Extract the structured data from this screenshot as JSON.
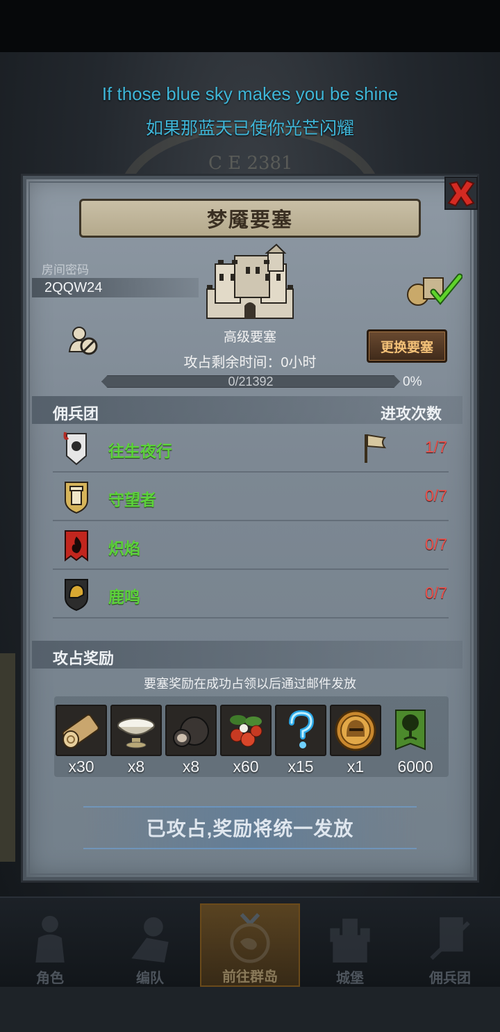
{
  "subtitles": {
    "en": "If those blue sky makes you be shine",
    "zh": "如果那蓝天已使你光芒闪耀"
  },
  "background": {
    "clock_text": "C E 2381"
  },
  "dialog": {
    "title": "梦魇要塞",
    "room_label": "房间密码",
    "room_code": "2QQW24",
    "castle_name": "高级要塞",
    "time_left": "攻占剩余时间：0小时",
    "change_button": "更换要塞",
    "progress": {
      "text": "0/21392",
      "percent_label": "0%",
      "fraction": 0
    },
    "mercenary_header": "佣兵团",
    "attacks_header": "进攻次数",
    "mercenaries": [
      {
        "name": "往生夜行",
        "count": "1/7",
        "emblem": "skull-banner-icon",
        "flag": true
      },
      {
        "name": "守望者",
        "count": "0/7",
        "emblem": "tower-shield-icon",
        "flag": false
      },
      {
        "name": "炽焰",
        "count": "0/7",
        "emblem": "flame-banner-icon",
        "flag": false
      },
      {
        "name": "鹿鸣",
        "count": "0/7",
        "emblem": "helmet-shield-icon",
        "flag": false
      }
    ],
    "rewards_header": "攻占奖励",
    "rewards_note": "要塞奖励在成功占领以后通过邮件发放",
    "rewards": [
      {
        "icon": "wood-log-icon",
        "qty": "x30"
      },
      {
        "icon": "silver-bowl-icon",
        "qty": "x8"
      },
      {
        "icon": "truffle-icon",
        "qty": "x8"
      },
      {
        "icon": "berries-icon",
        "qty": "x60"
      },
      {
        "icon": "mystery-question-icon",
        "qty": "x15"
      },
      {
        "icon": "gold-helmet-coin-icon",
        "qty": "x1"
      },
      {
        "icon": "tree-banner-icon",
        "qty": "6000"
      }
    ],
    "status_button": "已攻占,奖励将统一发放"
  },
  "nav": [
    {
      "label": "角色",
      "icon": "knight-icon"
    },
    {
      "label": "编队",
      "icon": "formation-icon"
    },
    {
      "label": "前往群岛",
      "icon": "islands-globe-icon",
      "active": true
    },
    {
      "label": "城堡",
      "icon": "castle-icon"
    },
    {
      "label": "佣兵团",
      "icon": "mercenary-icon"
    }
  ],
  "colors": {
    "subtitle": "#3fb6d8",
    "mercenary_name": "#5cd23a",
    "attack_count": "#e8534e",
    "change_button_text": "#f3c178"
  }
}
